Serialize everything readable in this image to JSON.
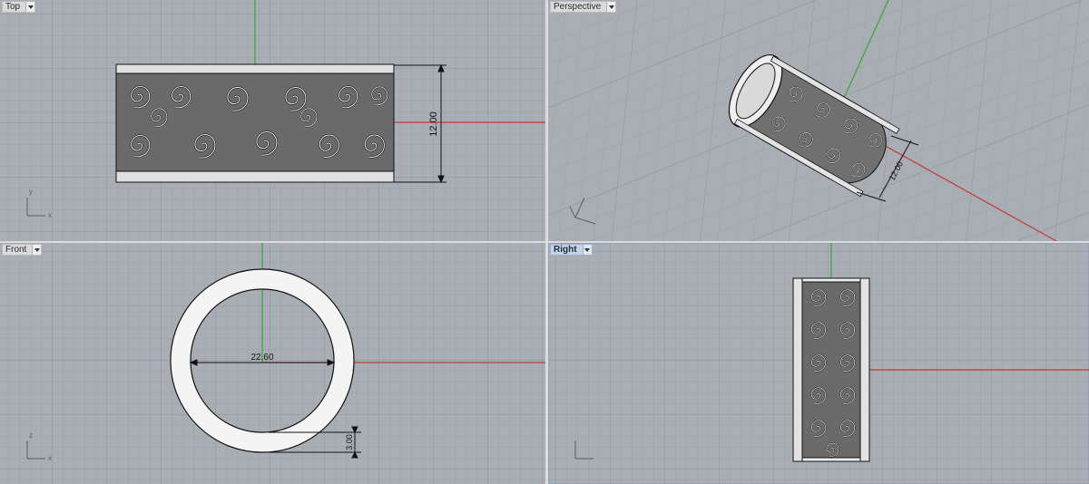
{
  "viewports": {
    "top": {
      "title": "Top",
      "dimension_height": "12.00",
      "axes": {
        "x": "x",
        "y": "y"
      }
    },
    "perspective": {
      "title": "Perspective",
      "dimension": "12.00"
    },
    "front": {
      "title": "Front",
      "dimension_diameter": "22.60",
      "dimension_thickness": "3.00",
      "axes": {
        "x": "x",
        "z": "z"
      }
    },
    "right": {
      "title": "Right",
      "active": true
    }
  },
  "colors": {
    "viewport_bg": "#a9aeb4",
    "grid_minor": "#9da2a8",
    "grid_major": "#8e949a",
    "axis_x": "#c23a3a",
    "axis_y": "#3aa33a",
    "ring_fill": "#f2f2f2",
    "outline": "#111111"
  },
  "icons": [
    "chevron-down-icon",
    "axis-gizmo-icon"
  ]
}
